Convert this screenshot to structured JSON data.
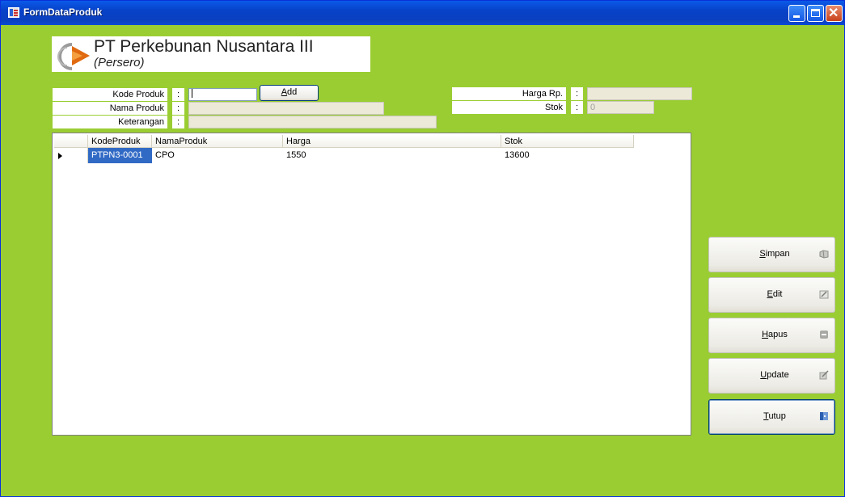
{
  "window": {
    "title": "FormDataProduk"
  },
  "logo": {
    "line1": "PT Perkebunan Nusantara III",
    "line2": "(Persero)"
  },
  "form": {
    "kode_label": "Kode Produk",
    "nama_label": "Nama Produk",
    "keterangan_label": "Keterangan",
    "harga_label": "Harga Rp.",
    "stok_label": "Stok",
    "colon": ":",
    "kode_value": "",
    "nama_value": "",
    "keterangan_value": "",
    "harga_value": "",
    "stok_value": "0",
    "add_label_first": "A",
    "add_label_rest": "dd"
  },
  "grid": {
    "columns": [
      "KodeProduk",
      "NamaProduk",
      "Harga",
      "Stok"
    ],
    "rows": [
      {
        "kode": "PTPN3-0001",
        "nama": "CPO",
        "harga": "1550",
        "stok": "13600"
      }
    ]
  },
  "actions": {
    "simpan": {
      "mnemonic": "S",
      "rest": "impan",
      "icon": "save-icon"
    },
    "edit": {
      "mnemonic": "E",
      "rest": "dit",
      "icon": "edit-icon"
    },
    "hapus": {
      "mnemonic": "H",
      "rest": "apus",
      "icon": "delete-icon"
    },
    "update": {
      "mnemonic": "U",
      "rest": "pdate",
      "icon": "update-icon"
    },
    "tutup": {
      "mnemonic": "T",
      "rest": "utup",
      "icon": "exit-icon"
    }
  },
  "colors": {
    "background": "#9acd32",
    "selection": "#316ac5",
    "titlebar": "#0842c8"
  }
}
